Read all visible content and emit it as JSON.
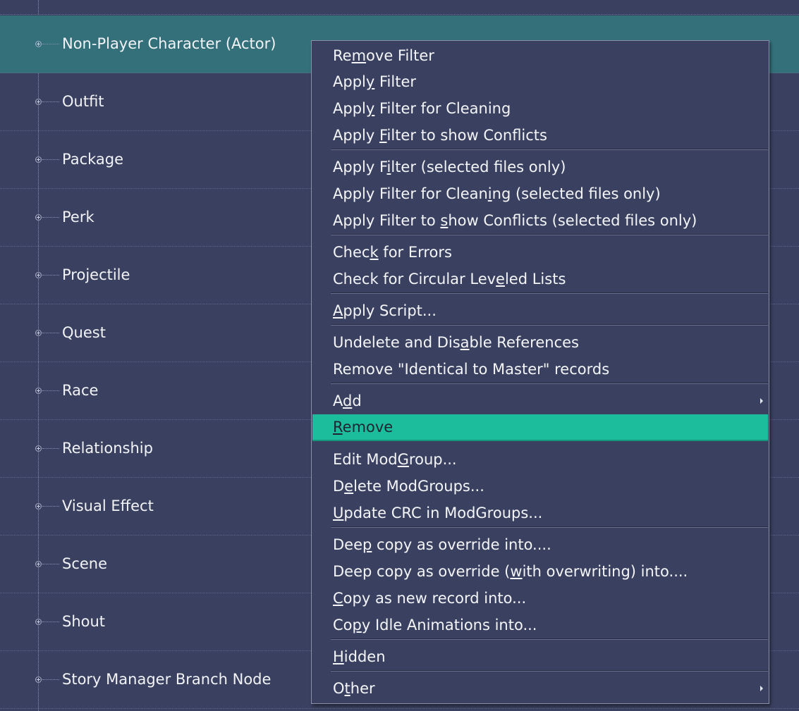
{
  "tree": {
    "rows": [
      {
        "label": "Non-Player Character (Actor)",
        "selected": true
      },
      {
        "label": "Outfit"
      },
      {
        "label": "Package"
      },
      {
        "label": "Perk"
      },
      {
        "label": "Projectile"
      },
      {
        "label": "Quest"
      },
      {
        "label": "Race"
      },
      {
        "label": "Relationship"
      },
      {
        "label": "Visual Effect"
      },
      {
        "label": "Scene"
      },
      {
        "label": "Shout"
      },
      {
        "label": "Story Manager Branch Node"
      }
    ]
  },
  "context_menu": {
    "items": [
      {
        "label": "Remove Filter",
        "access_key_index": 2
      },
      {
        "label": "Apply Filter",
        "access_key_index": 4
      },
      {
        "label": "Apply Filter for Cleaning",
        "access_key_index": 4
      },
      {
        "label": "Apply Filter to show Conflicts",
        "access_key_index": 6
      },
      {
        "label": "Apply Filter (selected files only)",
        "access_key_index": 7
      },
      {
        "label": "Apply Filter for Cleaning (selected files only)",
        "access_key_index": 22
      },
      {
        "label": "Apply Filter to show Conflicts (selected files only)",
        "access_key_index": 16
      },
      {
        "label": "Check for Errors",
        "access_key_index": 4
      },
      {
        "label": "Check for Circular Leveled Lists",
        "access_key_index": 22
      },
      {
        "label": "Apply Script...",
        "access_key_index": 0
      },
      {
        "label": "Undelete and Disable References",
        "access_key_index": 16
      },
      {
        "label": "Remove \"Identical to Master\" records",
        "access_key_index": -1
      },
      {
        "label": "Add",
        "access_key_index": 1,
        "submenu": true
      },
      {
        "label": "Remove",
        "access_key_index": 0,
        "highlighted": true
      },
      {
        "label": "Edit ModGroup...",
        "access_key_index": 8
      },
      {
        "label": "Delete ModGroups...",
        "access_key_index": 1
      },
      {
        "label": "Update CRC in ModGroups...",
        "access_key_index": 0
      },
      {
        "label": "Deep copy as override into....",
        "access_key_index": 3
      },
      {
        "label": "Deep copy as override (with overwriting) into....",
        "access_key_index": 23
      },
      {
        "label": "Copy as new record into...",
        "access_key_index": 0
      },
      {
        "label": "Copy Idle Animations into...",
        "access_key_index": 2
      },
      {
        "label": "Hidden",
        "access_key_index": 0
      },
      {
        "label": "Other",
        "access_key_index": 1,
        "submenu": true
      }
    ]
  },
  "colors": {
    "background": "#3a4160",
    "selected_row": "#33707a",
    "menu_highlight": "#1bbd9c",
    "text": "#f2f3f7"
  }
}
